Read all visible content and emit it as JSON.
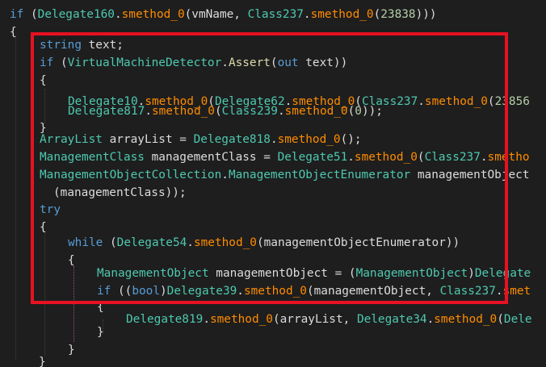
{
  "editor": {
    "lines": [
      {
        "tokens": [
          {
            "t": "if",
            "c": "kw"
          },
          {
            "t": " (",
            "c": "punc"
          },
          {
            "t": "Delegate160",
            "c": "type"
          },
          {
            "t": ".",
            "c": "punc"
          },
          {
            "t": "smethod_0",
            "c": "method2"
          },
          {
            "t": "(",
            "c": "punc"
          },
          {
            "t": "vmName",
            "c": "ident"
          },
          {
            "t": ", ",
            "c": "punc"
          },
          {
            "t": "Class237",
            "c": "type"
          },
          {
            "t": ".",
            "c": "punc"
          },
          {
            "t": "smethod_0",
            "c": "method2"
          },
          {
            "t": "(",
            "c": "punc"
          },
          {
            "t": "23838",
            "c": "num"
          },
          {
            "t": ")))",
            "c": "punc"
          }
        ]
      },
      {
        "tokens": [
          {
            "t": "{",
            "c": "punc"
          }
        ]
      },
      {
        "tokens": [
          {
            "t": "string",
            "c": "kw"
          },
          {
            "t": " text;",
            "c": "punc"
          }
        ]
      },
      {
        "tokens": [
          {
            "t": "if",
            "c": "kw"
          },
          {
            "t": " (",
            "c": "punc"
          },
          {
            "t": "VirtualMachineDetector",
            "c": "type"
          },
          {
            "t": ".",
            "c": "punc"
          },
          {
            "t": "Assert",
            "c": "method"
          },
          {
            "t": "(",
            "c": "punc"
          },
          {
            "t": "out",
            "c": "kw"
          },
          {
            "t": " text))",
            "c": "punc"
          }
        ]
      },
      {
        "tokens": [
          {
            "t": "{",
            "c": "punc"
          }
        ]
      },
      {
        "tokens": [
          {
            "t": "Delegate10",
            "c": "type"
          },
          {
            "t": ".",
            "c": "punc"
          },
          {
            "t": "smethod_0",
            "c": "method2"
          },
          {
            "t": "(",
            "c": "punc"
          },
          {
            "t": "Delegate62",
            "c": "type"
          },
          {
            "t": ".",
            "c": "punc"
          },
          {
            "t": "smethod_0",
            "c": "method2"
          },
          {
            "t": "(",
            "c": "punc"
          },
          {
            "t": "Class237",
            "c": "type"
          },
          {
            "t": ".",
            "c": "punc"
          },
          {
            "t": "smethod_0",
            "c": "method2"
          },
          {
            "t": "(",
            "c": "punc"
          },
          {
            "t": "23856",
            "c": "num"
          }
        ]
      },
      {
        "tokens": [
          {
            "t": "Delegate817",
            "c": "type"
          },
          {
            "t": ".",
            "c": "punc"
          },
          {
            "t": "smethod_0",
            "c": "method2"
          },
          {
            "t": "(",
            "c": "punc"
          },
          {
            "t": "Class239",
            "c": "type"
          },
          {
            "t": ".",
            "c": "punc"
          },
          {
            "t": "smethod_0",
            "c": "method2"
          },
          {
            "t": "(",
            "c": "punc"
          },
          {
            "t": "0",
            "c": "num"
          },
          {
            "t": "));",
            "c": "punc"
          }
        ]
      },
      {
        "tokens": [
          {
            "t": "}",
            "c": "punc"
          }
        ]
      },
      {
        "tokens": [
          {
            "t": "ArrayList",
            "c": "type"
          },
          {
            "t": " arrayList = ",
            "c": "punc"
          },
          {
            "t": "Delegate818",
            "c": "type"
          },
          {
            "t": ".",
            "c": "punc"
          },
          {
            "t": "smethod_0",
            "c": "method2"
          },
          {
            "t": "();",
            "c": "punc"
          }
        ]
      },
      {
        "tokens": [
          {
            "t": "ManagementClass",
            "c": "type"
          },
          {
            "t": " managementClass = ",
            "c": "punc"
          },
          {
            "t": "Delegate51",
            "c": "type"
          },
          {
            "t": ".",
            "c": "punc"
          },
          {
            "t": "smethod_0",
            "c": "method2"
          },
          {
            "t": "(",
            "c": "punc"
          },
          {
            "t": "Class237",
            "c": "type"
          },
          {
            "t": ".",
            "c": "punc"
          },
          {
            "t": "smetho",
            "c": "method2"
          }
        ]
      },
      {
        "tokens": [
          {
            "t": "ManagementObjectCollection",
            "c": "type"
          },
          {
            "t": ".",
            "c": "punc"
          },
          {
            "t": "ManagementObjectEnumerator",
            "c": "type"
          },
          {
            "t": " managementObject",
            "c": "punc"
          }
        ]
      },
      {
        "tokens": [
          {
            "t": "(managementClass));",
            "c": "punc"
          }
        ]
      },
      {
        "tokens": [
          {
            "t": "try",
            "c": "kw"
          }
        ]
      },
      {
        "tokens": [
          {
            "t": "{",
            "c": "punc"
          }
        ]
      },
      {
        "tokens": [
          {
            "t": "while",
            "c": "kw"
          },
          {
            "t": " (",
            "c": "punc"
          },
          {
            "t": "Delegate54",
            "c": "type"
          },
          {
            "t": ".",
            "c": "punc"
          },
          {
            "t": "smethod_0",
            "c": "method2"
          },
          {
            "t": "(managementObjectEnumerator))",
            "c": "punc"
          }
        ]
      },
      {
        "tokens": [
          {
            "t": "{",
            "c": "punc"
          }
        ]
      },
      {
        "tokens": [
          {
            "t": "ManagementObject",
            "c": "type"
          },
          {
            "t": " managementObject = (",
            "c": "punc"
          },
          {
            "t": "ManagementObject",
            "c": "type"
          },
          {
            "t": ")",
            "c": "punc"
          },
          {
            "t": "Delegate",
            "c": "type"
          }
        ]
      },
      {
        "tokens": [
          {
            "t": "if",
            "c": "kw"
          },
          {
            "t": " ((",
            "c": "punc"
          },
          {
            "t": "bool",
            "c": "kw"
          },
          {
            "t": ")",
            "c": "punc"
          },
          {
            "t": "Delegate39",
            "c": "type"
          },
          {
            "t": ".",
            "c": "punc"
          },
          {
            "t": "smethod_0",
            "c": "method2"
          },
          {
            "t": "(managementObject, ",
            "c": "punc"
          },
          {
            "t": "Class237",
            "c": "type"
          },
          {
            "t": ".",
            "c": "punc"
          },
          {
            "t": "smet",
            "c": "method2"
          }
        ]
      },
      {
        "tokens": [
          {
            "t": "{",
            "c": "punc"
          }
        ]
      },
      {
        "tokens": [
          {
            "t": "Delegate819",
            "c": "type"
          },
          {
            "t": ".",
            "c": "punc"
          },
          {
            "t": "smethod_0",
            "c": "method2"
          },
          {
            "t": "(arrayList, ",
            "c": "punc"
          },
          {
            "t": "Delegate34",
            "c": "type"
          },
          {
            "t": ".",
            "c": "punc"
          },
          {
            "t": "smethod_0",
            "c": "method2"
          },
          {
            "t": "(",
            "c": "punc"
          },
          {
            "t": "Dele",
            "c": "type"
          }
        ]
      },
      {
        "tokens": [
          {
            "t": "}",
            "c": "punc"
          }
        ]
      },
      {
        "tokens": [
          {
            "t": "}",
            "c": "punc"
          }
        ]
      },
      {
        "tokens": [
          {
            "t": "}",
            "c": "punc"
          }
        ]
      }
    ]
  },
  "colors": {
    "background": "#1e1e1e",
    "keyword": "#569cd6",
    "type": "#4ec9b0",
    "method": "#dcdcaa",
    "method_alt": "#ff8c00",
    "number": "#b5cea8",
    "text": "#dcdcdc",
    "highlight": "#e81123"
  }
}
